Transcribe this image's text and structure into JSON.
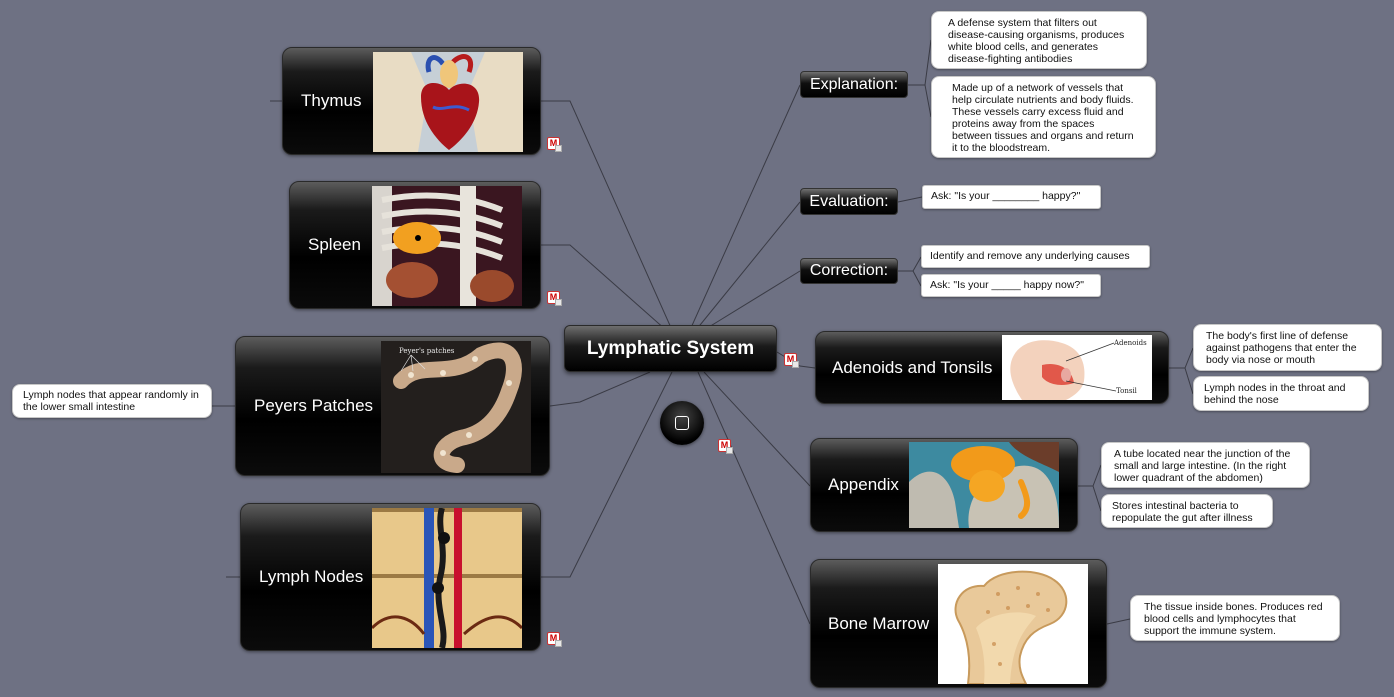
{
  "center": {
    "title": "Lymphatic System"
  },
  "left_topics": [
    {
      "label": "Thymus",
      "image": "heart-and-thymus-illustration"
    },
    {
      "label": "Spleen",
      "image": "spleen-behind-ribcage-illustration"
    },
    {
      "label": "Peyers Patches",
      "image": "peyers-patches-intestine-photo",
      "image_caption": "Peyer's patches",
      "note": "Lymph nodes that appear randomly in the lower small intestine"
    },
    {
      "label": "Lymph Nodes",
      "image": "lymph-node-vessels-illustration"
    }
  ],
  "right_categories": [
    {
      "label": "Explanation:",
      "notes": [
        "A defense system that filters out disease-causing organisms, produces white blood cells, and generates disease-fighting antibodies",
        "Made up of a network of vessels that help circulate nutrients and body fluids. These vessels carry excess fluid and proteins away from the spaces between tissues and organs and return it to the bloodstream."
      ]
    },
    {
      "label": "Evaluation:",
      "notes": [
        "Ask: \"Is your ________ happy?\""
      ]
    },
    {
      "label": "Correction:",
      "notes": [
        "Identify and remove any underlying causes",
        "Ask: \"Is your _____ happy now?\""
      ]
    }
  ],
  "right_topics": [
    {
      "label": "Adenoids and Tonsils",
      "image": "adenoids-tonsil-diagram",
      "image_labels": [
        "Adenoids",
        "Tonsil"
      ],
      "notes": [
        "The body's first line of defense against pathogens that enter the body via nose or mouth",
        "Lymph nodes in the throat and behind the nose"
      ]
    },
    {
      "label": "Appendix",
      "image": "appendix-illustration",
      "notes": [
        "A tube located near the junction of the small and large intestine. (In the right lower quadrant of the abdomen)",
        "Stores intestinal bacteria to repopulate the gut after illness"
      ]
    },
    {
      "label": "Bone Marrow",
      "image": "bone-marrow-femur-illustration",
      "notes": [
        "The tissue inside bones. Produces red blood cells and lymphocytes that support the immune system."
      ]
    }
  ],
  "icons": {
    "note_icon": "mindmap-note-icon",
    "float_button": "square-toggle-icon"
  },
  "colors": {
    "background": "#6e7183",
    "connector": "#3a3b45",
    "node": "#000000",
    "note": "#ffffff"
  }
}
